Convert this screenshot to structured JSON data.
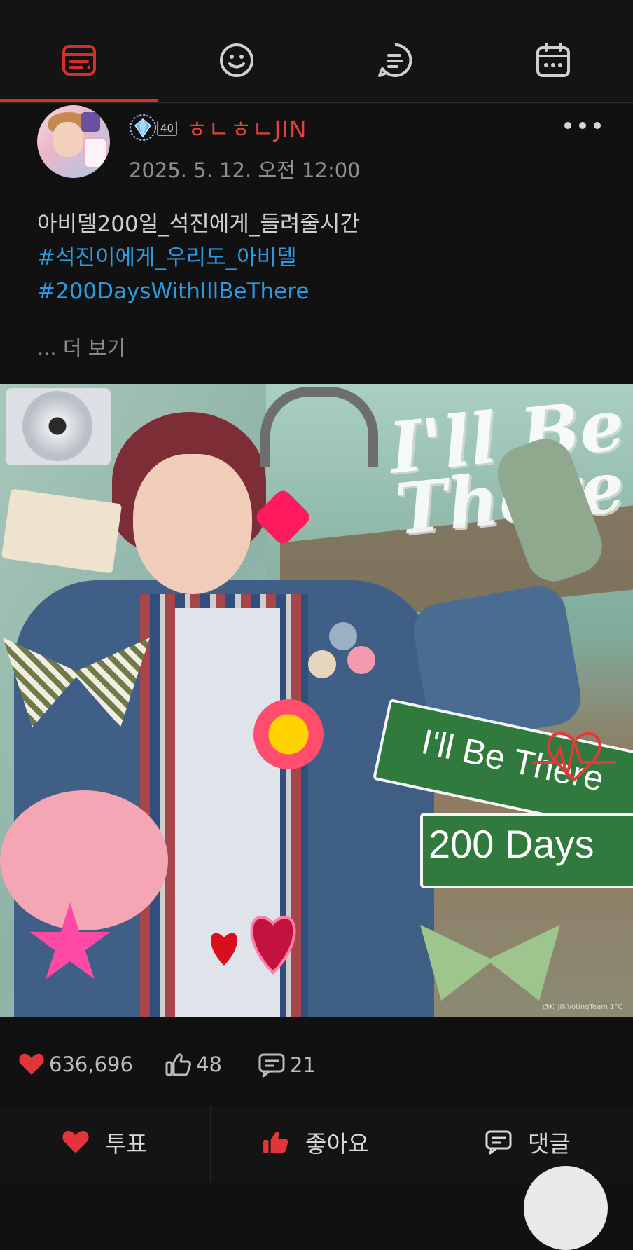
{
  "tabs": [
    {
      "name": "feed",
      "icon": "feed-icon",
      "active": true
    },
    {
      "name": "emoji",
      "icon": "smiley-icon",
      "active": false
    },
    {
      "name": "posts",
      "icon": "list-bubble-icon",
      "active": false
    },
    {
      "name": "calendar",
      "icon": "calendar-icon",
      "active": false
    }
  ],
  "colors": {
    "accent": "#d3302b",
    "hashtag": "#2a9ae3",
    "username": "#e2423c",
    "background": "#111111"
  },
  "post": {
    "author": {
      "level": "40",
      "username": "ㅎㄴㅎㄴJIN"
    },
    "timestamp": "2025. 5. 12. 오전 12:00",
    "text_line": "아비델200일_석진에게_들려줄시간",
    "hashtags": [
      "#석진이에게_우리도_아비델",
      "#200DaysWithIllBeThere"
    ],
    "see_more": "... 더 보기",
    "image": {
      "sign_line1": "I'll Be There",
      "sign_line2": "200 Days",
      "title_art": "I'll Be There",
      "watermark": "@K_JINVotingTeam 1°C"
    }
  },
  "stats": {
    "votes": "636,696",
    "likes": "48",
    "comments": "21"
  },
  "actions": {
    "vote_label": "투표",
    "like_label": "좋아요",
    "comment_label": "댓글"
  }
}
